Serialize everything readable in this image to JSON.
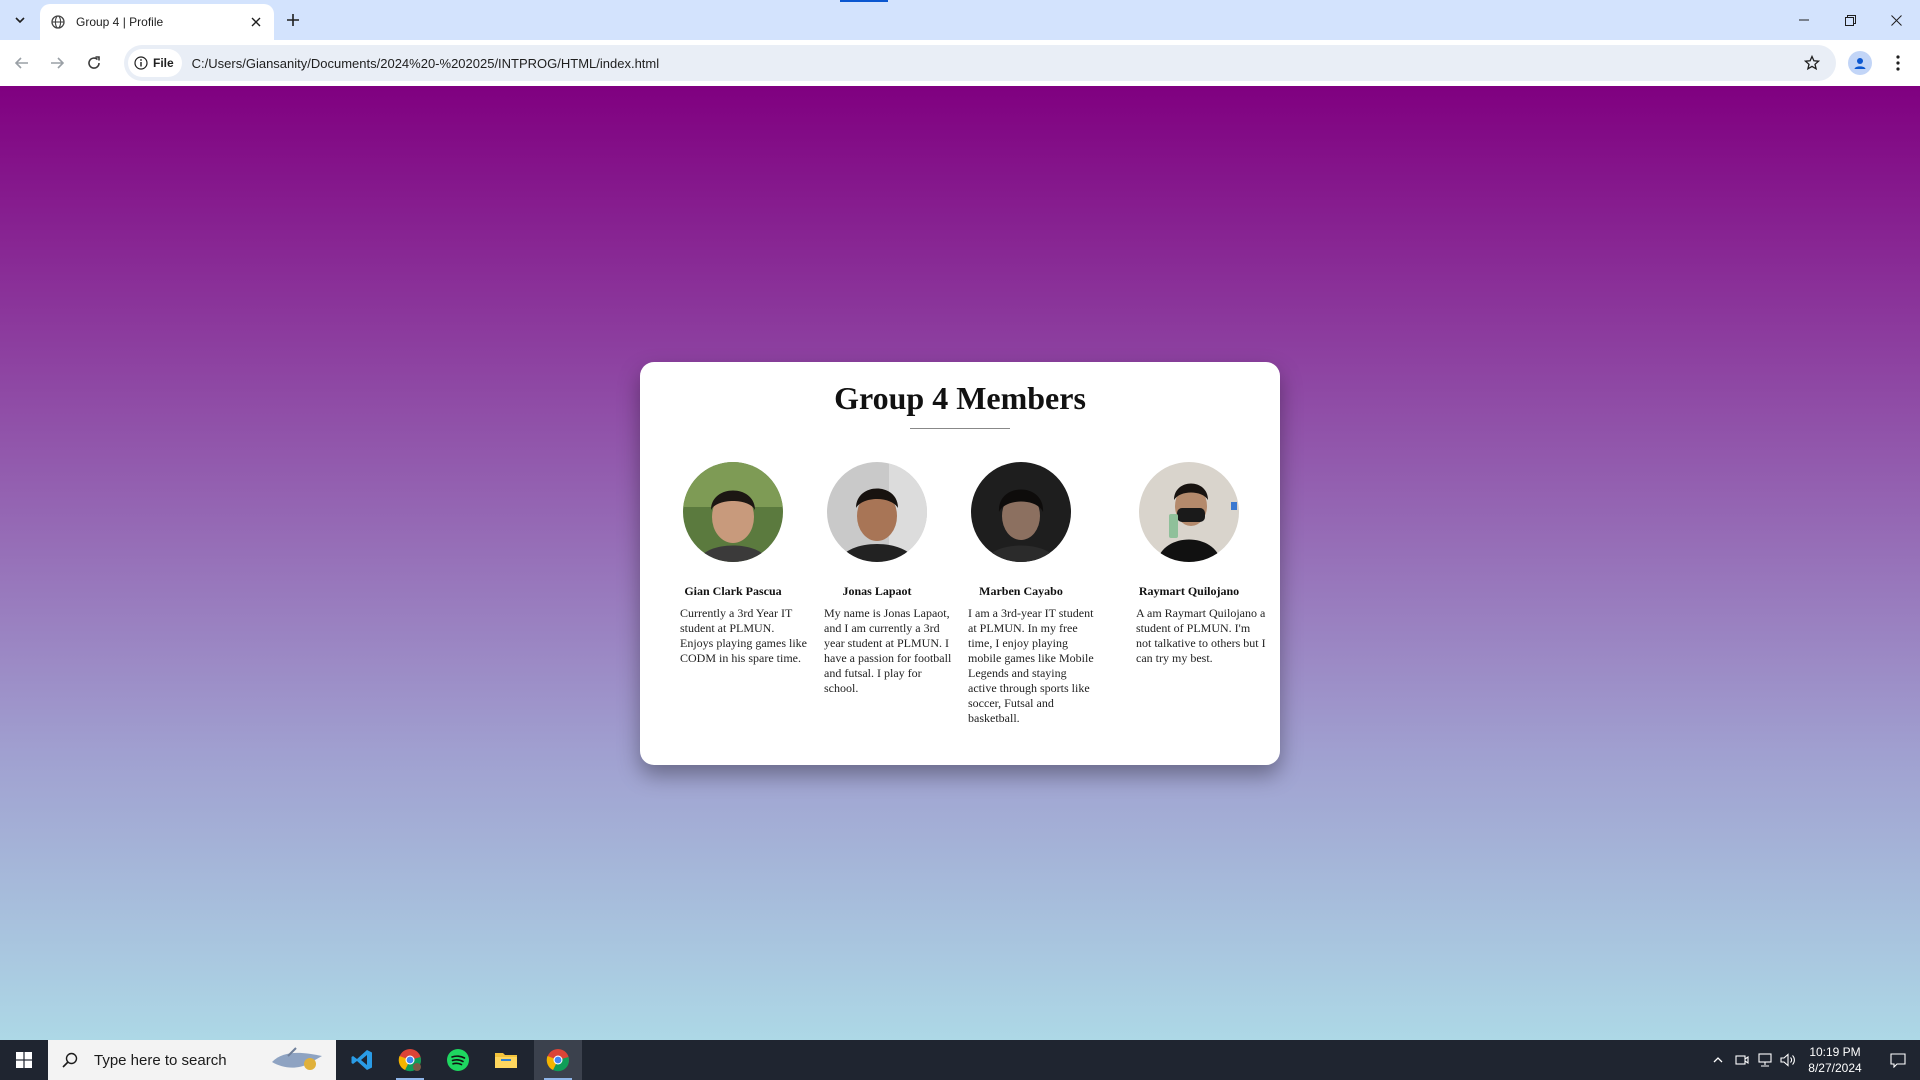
{
  "browser": {
    "tab_title": "Group 4 | Profile",
    "site_chip": "File",
    "url": "C:/Users/Giansanity/Documents/2024%20-%202025/INTPROG/HTML/index.html"
  },
  "page": {
    "heading": "Group 4 Members",
    "members": [
      {
        "name": "Gian Clark Pascua",
        "bio": "Currently a 3rd Year IT student at PLMUN. Enjoys playing games like CODM in his spare time."
      },
      {
        "name": "Jonas Lapaot",
        "bio": "My name is Jonas Lapaot, and I am currently a 3rd year student at PLMUN. I have a passion for football and futsal. I play for school."
      },
      {
        "name": "Marben Cayabo",
        "bio": "I am a 3rd-year IT student at PLMUN. In my free time, I enjoy playing mobile games like Mobile Legends and staying active through sports like soccer, Futsal and basketball."
      },
      {
        "name": "Raymart Quilojano",
        "bio": "A am Raymart Quilojano a student of PLMUN. I'm not talkative to others but I can try my best."
      }
    ],
    "gradient_colors": [
      "#800080",
      "#add8e6"
    ]
  },
  "taskbar": {
    "search_placeholder": "Type here to search",
    "time": "10:19 PM",
    "date": "8/27/2024"
  }
}
